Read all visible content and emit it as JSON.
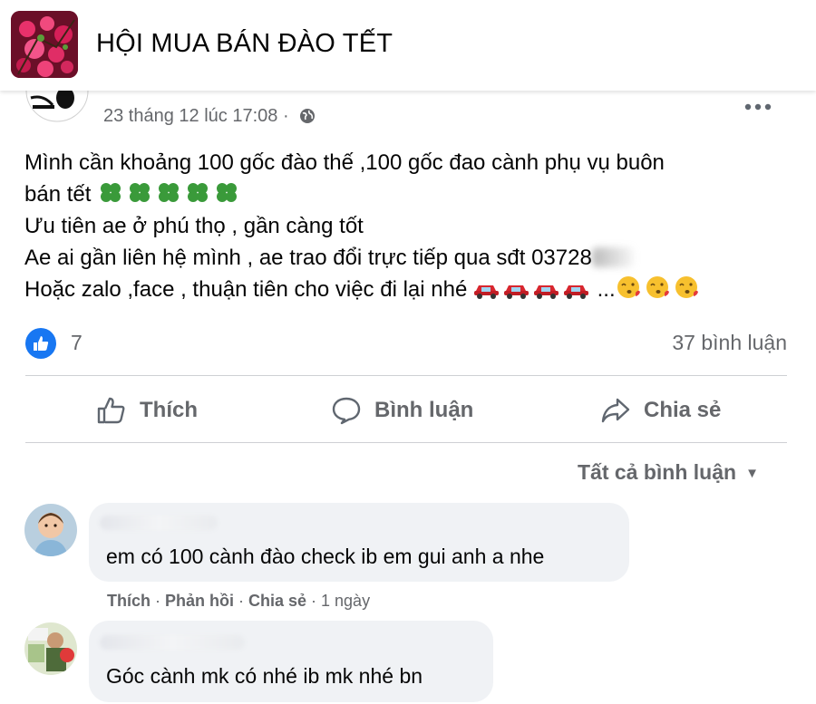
{
  "header": {
    "group_title": "HỘI MUA BÁN ĐÀO TẾT"
  },
  "post": {
    "timestamp": "23 tháng 12 lúc 17:08 ·",
    "lines": [
      "Mình cần khoảng 100 gốc đào thế ,100 gốc đao cành phụ vụ buôn",
      "bán tết",
      "Ưu tiên ae ở phú thọ , gần càng tốt",
      "Ae ai gần liên hệ mình , ae trao đổi trực tiếp qua sđt 03728",
      "Hoặc zalo ,face , thuận tiên cho việc đi lại nhé",
      "..."
    ],
    "like_count": "7",
    "comment_count": "37 bình luận",
    "actions": {
      "like": "Thích",
      "comment": "Bình luận",
      "share": "Chia sẻ"
    },
    "filter_label": "Tất cả bình luận"
  },
  "comments": [
    {
      "text": "em có 100 cành đào check ib em gui anh a nhe",
      "actions": {
        "like": "Thích",
        "sep1": " · ",
        "reply": "Phản hồi",
        "sep2": " · ",
        "share": "Chia sẻ",
        "time": " · 1 ngày"
      }
    },
    {
      "text": "Góc cành mk có nhé ib mk nhé bn"
    }
  ],
  "colors": {
    "accent": "#1877f2",
    "secondary_text": "#65676b",
    "bubble_bg": "#f0f2f5",
    "divider": "#ced0d4"
  },
  "icons": [
    "globe-icon",
    "more-options-icon",
    "clover-emoji",
    "car-emoji",
    "kiss-emoji",
    "like-thumb-icon",
    "comment-icon",
    "share-icon",
    "caret-down-icon"
  ]
}
